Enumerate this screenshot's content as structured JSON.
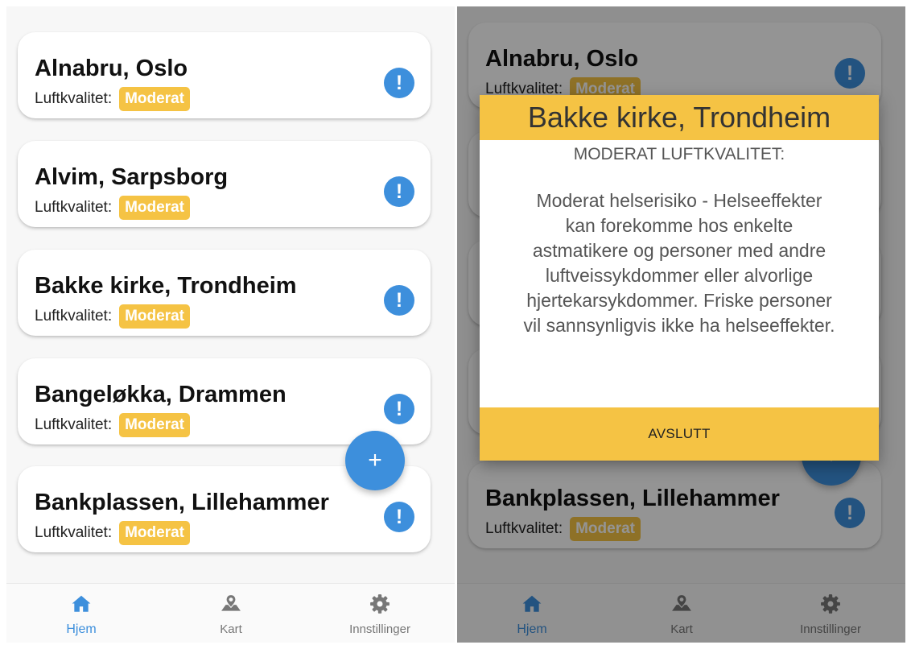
{
  "colors": {
    "accent": "#3d8fdc",
    "badge": "#f5c344",
    "text": "#111111",
    "tab_inactive": "#777777"
  },
  "stations": [
    {
      "name": "Alnabru, Oslo",
      "label": "Luftkvalitet:",
      "quality": "Moderat"
    },
    {
      "name": "Alvim, Sarpsborg",
      "label": "Luftkvalitet:",
      "quality": "Moderat"
    },
    {
      "name": "Bakke kirke, Trondheim",
      "label": "Luftkvalitet:",
      "quality": "Moderat"
    },
    {
      "name": "Bangeløkka, Drammen",
      "label": "Luftkvalitet:",
      "quality": "Moderat"
    },
    {
      "name": "Bankplassen, Lillehammer",
      "label": "Luftkvalitet:",
      "quality": "Moderat"
    }
  ],
  "icons": {
    "info": "!",
    "add": "+",
    "home": "home-icon",
    "map": "map-icon",
    "settings": "gear-icon"
  },
  "tabs": [
    {
      "label": "Hjem",
      "active": true
    },
    {
      "label": "Kart",
      "active": false
    },
    {
      "label": "Innstillinger",
      "active": false
    }
  ],
  "modal": {
    "title": "Bakke kirke, Trondheim",
    "heading": "MODERAT LUFTKVALITET:",
    "lines": [
      "Moderat helserisiko - Helseeffekter",
      "kan forekomme hos enkelte",
      "astmatikere og personer med andre",
      "luftveissykdommer eller alvorlige",
      "hjertekarsykdommer. Friske personer",
      "vil sannsynligvis ikke ha helseeffekter."
    ],
    "close_label": "AVSLUTT"
  }
}
